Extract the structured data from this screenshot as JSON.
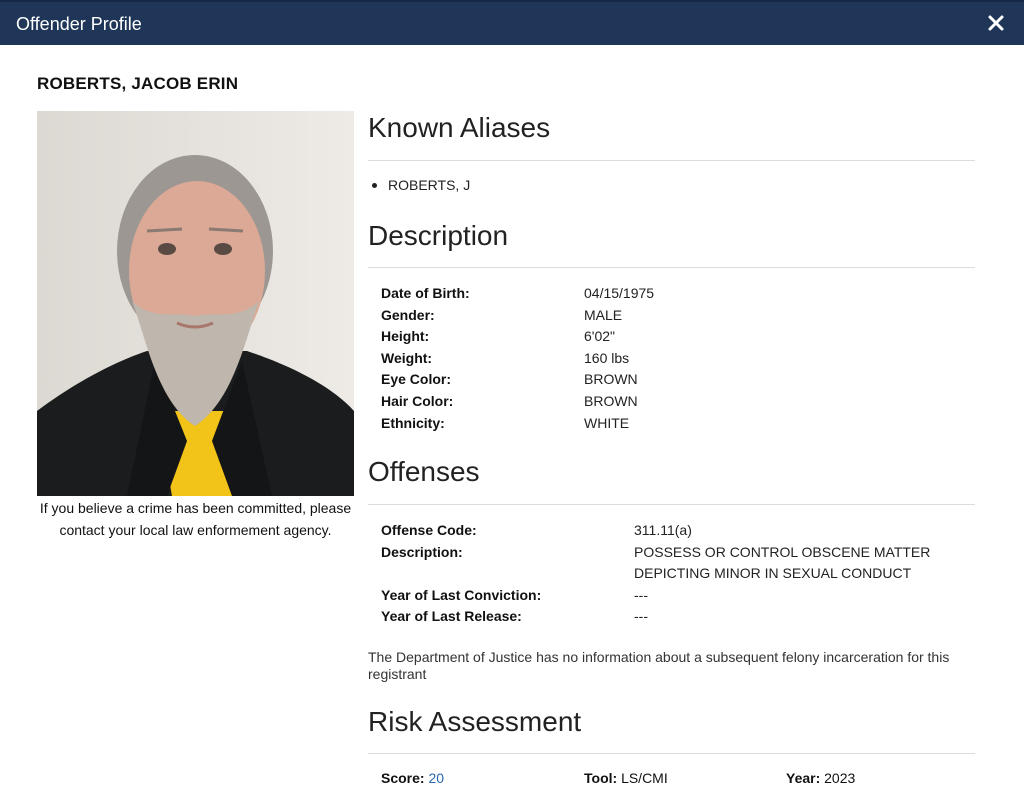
{
  "dialog": {
    "title": "Offender Profile",
    "close_icon": "close-icon"
  },
  "offender": {
    "name": "ROBERTS, JACOB ERIN",
    "photo_caption": "If you believe a crime has been committed, please contact your local law enformement agency."
  },
  "aliases": {
    "heading": "Known Aliases",
    "items": [
      "ROBERTS, J"
    ]
  },
  "description": {
    "heading": "Description",
    "rows": [
      {
        "label": "Date of Birth:",
        "value": "04/15/1975"
      },
      {
        "label": "Gender:",
        "value": "MALE"
      },
      {
        "label": "Height:",
        "value": "6'02\""
      },
      {
        "label": "Weight:",
        "value": "160 lbs"
      },
      {
        "label": "Eye Color:",
        "value": "BROWN"
      },
      {
        "label": "Hair Color:",
        "value": "BROWN"
      },
      {
        "label": "Ethnicity:",
        "value": "WHITE"
      }
    ]
  },
  "offenses": {
    "heading": "Offenses",
    "rows": [
      {
        "label": "Offense Code:",
        "value": "311.11(a)"
      },
      {
        "label": "Description:",
        "value": "POSSESS OR CONTROL OBSCENE MATTER"
      },
      {
        "label": "",
        "value": "DEPICTING MINOR IN SEXUAL CONDUCT"
      },
      {
        "label": "Year of Last Conviction:",
        "value": "---"
      },
      {
        "label": "Year of Last Release:",
        "value": "---"
      }
    ],
    "note": "The Department of Justice has no information about a subsequent felony incarceration for this registrant"
  },
  "risk": {
    "heading": "Risk Assessment",
    "score_label": "Score:",
    "score_value": "20",
    "tool_label": "Tool:",
    "tool_value": "LS/CMI",
    "year_label": "Year:",
    "year_value": "2023"
  },
  "colors": {
    "header_bg": "#1f3658",
    "link": "#2a67b0"
  }
}
